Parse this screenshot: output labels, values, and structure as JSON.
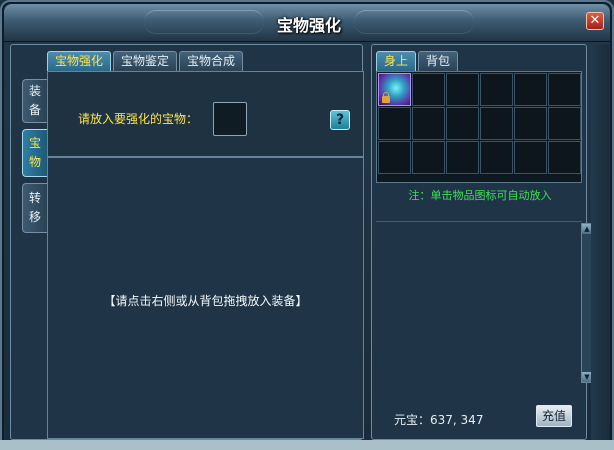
{
  "window": {
    "title": "宝物强化",
    "close_label": "✕"
  },
  "tabs": [
    "宝物强化",
    "宝物鉴定",
    "宝物合成"
  ],
  "side_tabs": [
    {
      "label": "装\n备",
      "active": false
    },
    {
      "label": "宝\n物",
      "active": true
    },
    {
      "label": "转\n移",
      "active": false
    }
  ],
  "enhance": {
    "prompt": "请放入要强化的宝物：",
    "help_label": "?",
    "center_hint": "【请点击右侧或从背包拖拽放入装备】"
  },
  "inventory": {
    "tabs": [
      "身上",
      "背包"
    ],
    "note": "注：单击物品图标可自动放入",
    "currency_label": "元宝：",
    "currency_value": "637, 347",
    "recharge_label": "充值",
    "item_icon": "crystal-treasure-icon"
  },
  "colors": {
    "accent_yellow": "#ffe44a",
    "note_green": "#3ee05a"
  }
}
